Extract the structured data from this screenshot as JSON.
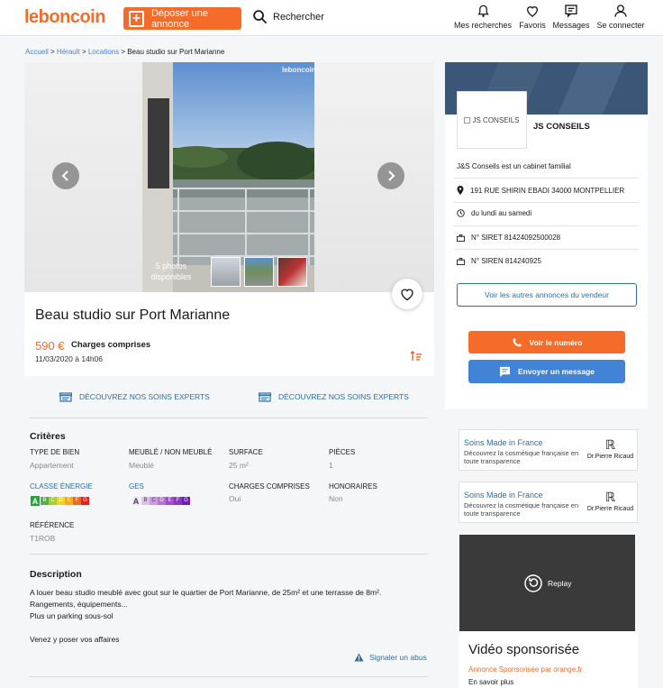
{
  "header": {
    "logo": "leboncoin",
    "post_button": "Déposer une annonce",
    "search": "Rechercher",
    "nav": [
      {
        "icon": "bell-icon",
        "label": "Mes recherches"
      },
      {
        "icon": "heart-icon",
        "label": "Favoris"
      },
      {
        "icon": "message-icon",
        "label": "Messages"
      },
      {
        "icon": "user-icon",
        "label": "Se connecter"
      }
    ]
  },
  "breadcrumb": {
    "home": "Accueil",
    "region": "Hérault",
    "category": "Locations",
    "current": "Beau studio sur Port Marianne"
  },
  "listing": {
    "watermark": "leboncoin",
    "photos_count": "5 photos disponibles",
    "title": "Beau studio sur Port Marianne",
    "price": "590 €",
    "charges": "Charges comprises",
    "date": "11/03/2020 à 14h06"
  },
  "promos": [
    "DÉCOUVREZ NOS SOINS EXPERTS",
    "DÉCOUVREZ NOS SOINS EXPERTS"
  ],
  "criteria": {
    "title": "Critères",
    "type_label": "TYPE DE BIEN",
    "type_value": "Appartement",
    "furnished_label": "MEUBLÉ / NON MEUBLÉ",
    "furnished_value": "Meublé",
    "surface_label": "SURFACE",
    "surface_value": "25 m²",
    "rooms_label": "PIÈCES",
    "rooms_value": "1",
    "energy_label": "CLASSE ÉNERGIE",
    "energy_selected": "A",
    "ges_label": "GES",
    "ges_selected": "A",
    "charges_label": "CHARGES COMPRISES",
    "charges_value": "Oui",
    "fees_label": "HONORAIRES",
    "fees_value": "Non",
    "ref_label": "RÉFÉRENCE",
    "ref_value": "T1ROB",
    "energy_letters": [
      "A",
      "B",
      "C",
      "D",
      "E",
      "F",
      "G"
    ],
    "energy_colors": [
      "#2a9d3f",
      "#52b447",
      "#a4cc3c",
      "#f2d51a",
      "#f4a923",
      "#ec6a24",
      "#e2231a"
    ],
    "ges_colors": [
      "#f4e8f7",
      "#dcc2ea",
      "#c79ce0",
      "#b275d6",
      "#9d4fcb",
      "#873ac0",
      "#6b1fae"
    ]
  },
  "description": {
    "title": "Description",
    "line1": "A louer beau studio meublé avec gout sur le quartier de Port Marianne, de 25m² et une terrasse de 8m².",
    "line2": "Rangements, équipements...",
    "line3": "Plus un parking sous-sol",
    "line4": "Venez y poser vos affaires",
    "report": "Signaler un abus"
  },
  "seller": {
    "logo_alt": "JS CONSEILS",
    "name": "JS CONSEILS",
    "tagline": "J&S Conseils est un cabinet familial",
    "address": "191 RUE SHIRIN EBADI 34000 MONTPELLIER",
    "hours": "du lundi au samedi",
    "siret": "N° SIRET 81424092500028",
    "siren": "N° SIREN 814240925",
    "other_ads": "Voir les autres annonces du vendeur",
    "call": "Voir le numéro",
    "message": "Envoyer un message"
  },
  "ads": [
    {
      "title": "Soins Made in France",
      "subtitle": "Découvrez la cosmétique française en toute transparence",
      "brand": "Dr.Pierre Ricaud"
    },
    {
      "title": "Soins Made in France",
      "subtitle": "Découvrez la cosmétique française en toute transparence",
      "brand": "Dr.Pierre Ricaud"
    }
  ],
  "video": {
    "replay": "Replay",
    "title": "Vidéo sponsorisée",
    "sponsor": "Annonce Sponsorisée par orange.fr",
    "more": "En savoir plus"
  },
  "colors": {
    "brand": "#f56b2a",
    "link": "#2c6fa8",
    "message_button": "#4183d7"
  }
}
